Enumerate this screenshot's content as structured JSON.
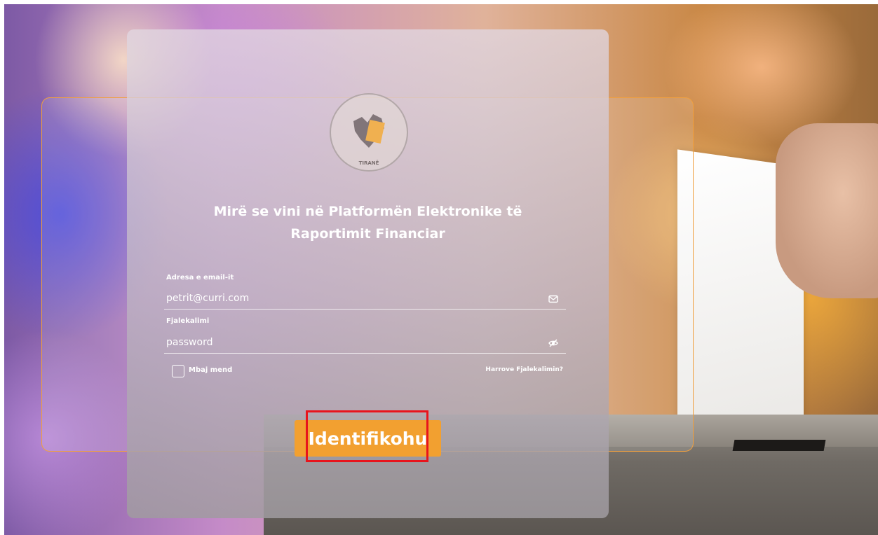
{
  "login": {
    "title_line1": "Mirë se vini në Platformën Elektronike të",
    "title_line2": "Raportimit Financiar",
    "email_label": "Adresa e email-it",
    "email_value": "petrit@curri.com",
    "password_label": "Fjalekalimi",
    "password_placeholder": "password",
    "remember_label": "Mbaj mend",
    "forgot_link": "Harrove Fjalekalimin?",
    "submit_label": "Identifikohu"
  },
  "seal": {
    "text": "TIRANË"
  },
  "colors": {
    "accent": "#f2a030",
    "highlight": "#e8141c"
  },
  "icons": {
    "email": "mail-icon",
    "password": "eye-off-icon"
  }
}
